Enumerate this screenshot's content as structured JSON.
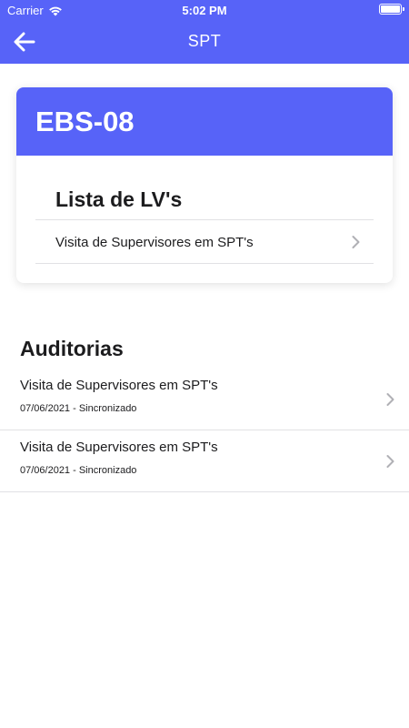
{
  "status_bar": {
    "carrier": "Carrier",
    "time": "5:02 PM"
  },
  "nav": {
    "title": "SPT",
    "back_icon": "arrow-left-icon"
  },
  "card": {
    "code": "EBS-08",
    "section_title": "Lista de LV's",
    "items": [
      {
        "label": "Visita de Supervisores em SPT's"
      }
    ]
  },
  "audits": {
    "title": "Auditorias",
    "items": [
      {
        "title": "Visita de Supervisores em SPT's",
        "subtitle": "07/06/2021 - Sincronizado"
      },
      {
        "title": "Visita de Supervisores em SPT's",
        "subtitle": "07/06/2021 - Sincronizado"
      }
    ]
  },
  "colors": {
    "primary": "#5763f8",
    "chevron": "#b0b0b5",
    "divider": "#e1e1e4"
  }
}
